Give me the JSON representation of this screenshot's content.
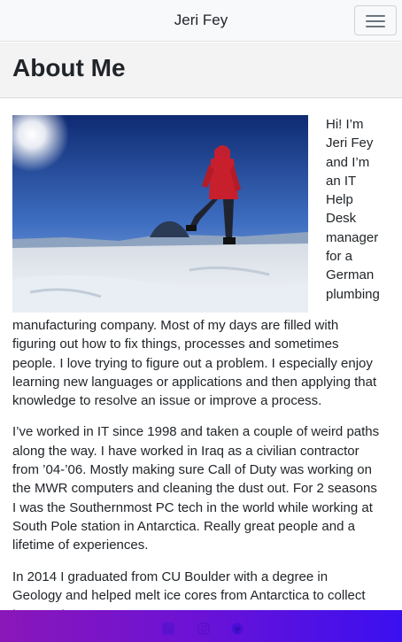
{
  "navbar": {
    "brand": "Jeri Fey",
    "toggle_icon": "hamburger-menu-icon"
  },
  "header": {
    "title": "About Me"
  },
  "photo": {
    "icon": "antarctica-photo"
  },
  "content": {
    "paragraphs": [
      "Hi! I’m Jeri Fey and I’m an IT Help Desk manager for a German plumbing manufacturing company. Most of my days are filled with figuring out how to fix things, processes and sometimes people. I love trying to figure out a problem. I especially enjoy learning new languages or applications and then applying that knowledge to resolve an issue or improve a process.",
      "I’ve worked in IT since 1998 and taken a couple of weird paths along the way. I have worked in Iraq as a civilian contractor from ’04-’06. Mostly making sure Call of Duty was working on the MWR computers and cleaning the dust out. For 2 seasons I was the Southernmost PC tech in the world while working at South Pole station in Antarctica. Really great people and a lifetime of experiences.",
      "In 2014 I graduated from CU Boulder with a degree in Geology and helped melt ice cores from Antarctica to collect temperature"
    ]
  },
  "footer": {
    "icons": [
      "linkedin-icon",
      "instagram-icon",
      "github-icon"
    ],
    "gradient_colors": [
      "#8a17b8",
      "#3a10f0"
    ]
  }
}
